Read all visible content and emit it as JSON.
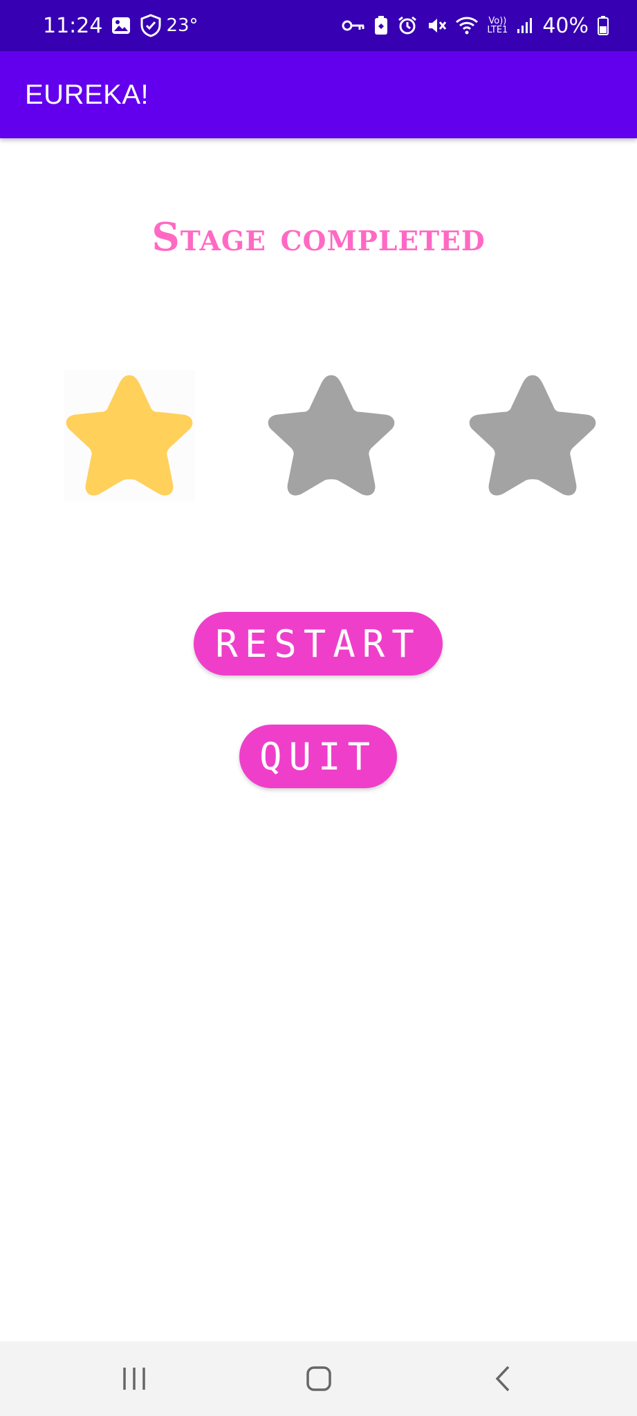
{
  "status_bar": {
    "time": "11:24",
    "temperature": "23°",
    "battery": "40%",
    "icons": [
      "gallery-icon",
      "shield-icon",
      "key-icon",
      "battery-saver-icon",
      "alarm-icon",
      "mute-icon",
      "wifi-icon",
      "volte-icon",
      "signal-icon",
      "battery-icon"
    ],
    "network_label_top": "Vo))",
    "network_label_bottom": "LTE1"
  },
  "app_bar": {
    "title": "EUREKA!"
  },
  "main": {
    "stage_title": "Stage completed",
    "stars": {
      "earned": 1,
      "total": 3,
      "earned_color": "#ffd05a",
      "empty_color": "#a3a3a3"
    },
    "restart_label": "RESTART",
    "quit_label": "QUIT"
  },
  "nav_bar": {
    "items": [
      "recent-apps",
      "home",
      "back"
    ]
  },
  "colors": {
    "status_bar": "#3700b3",
    "app_bar": "#6200ee",
    "title_pink": "#ff69c4",
    "button_pink": "#ef3fca"
  }
}
